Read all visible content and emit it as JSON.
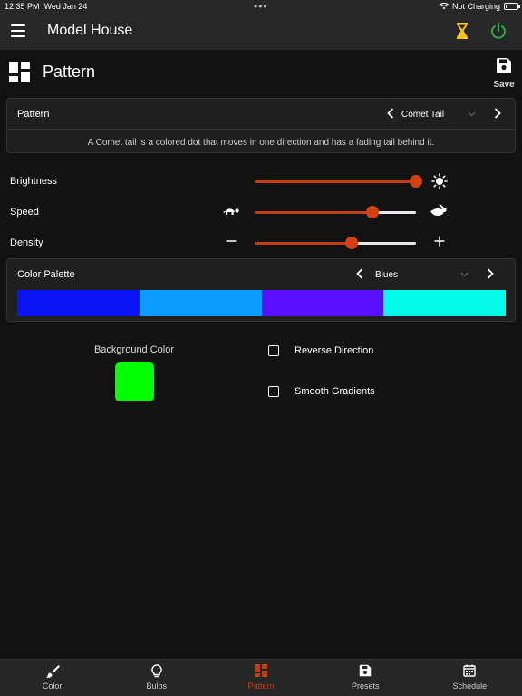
{
  "status": {
    "time": "12:35 PM",
    "date": "Wed Jan 24",
    "dots": "•••",
    "wifi_icon": "wifi-icon",
    "battery_text": "Not Charging",
    "battery_level": 0.05
  },
  "nav": {
    "title": "Model House",
    "timer_color": "#f5c518",
    "power_color": "#2ea84a"
  },
  "page": {
    "title": "Pattern",
    "save_label": "Save"
  },
  "pattern": {
    "label": "Pattern",
    "selected": "Comet Tail",
    "description": "A Comet tail is a colored dot that moves in one direction and has a fading tail behind it."
  },
  "sliders": [
    {
      "name": "Brightness",
      "icon_left": "moon-icon",
      "icon_right": "sun-icon",
      "value": 1.0
    },
    {
      "name": "Speed",
      "icon_left": "turtle-icon",
      "icon_right": "rabbit-icon",
      "value": 0.73
    },
    {
      "name": "Density",
      "icon_left": "minus-icon",
      "icon_right": "plus-icon",
      "value": 0.6
    }
  ],
  "palette": {
    "label": "Color Palette",
    "selected": "Blues",
    "colors": [
      "#0a14f5",
      "#0d9bff",
      "#5a10ff",
      "#00fce8"
    ]
  },
  "background": {
    "label": "Background Color",
    "color": "#00ff00"
  },
  "options": {
    "reverse_label": "Reverse Direction",
    "reverse_checked": false,
    "smooth_label": "Smooth Gradients",
    "smooth_checked": false
  },
  "tabs": [
    {
      "label": "Color",
      "icon": "brush-icon",
      "active": false
    },
    {
      "label": "Bulbs",
      "icon": "bulb-icon",
      "active": false
    },
    {
      "label": "Pattern",
      "icon": "pattern-grid-icon",
      "active": true
    },
    {
      "label": "Presets",
      "icon": "save-icon",
      "active": false
    },
    {
      "label": "Schedule",
      "icon": "calendar-icon",
      "active": false
    }
  ],
  "colors": {
    "accent": "#c53d13",
    "background": "#121212",
    "card": "#1f1f1f"
  }
}
